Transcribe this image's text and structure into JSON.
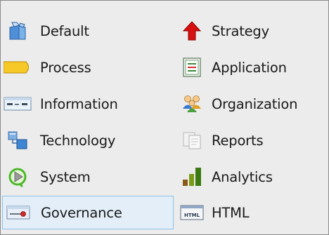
{
  "items": [
    {
      "label": "Default",
      "icon": "default-icon"
    },
    {
      "label": "Strategy",
      "icon": "strategy-icon"
    },
    {
      "label": "Process",
      "icon": "process-icon"
    },
    {
      "label": "Application",
      "icon": "application-icon"
    },
    {
      "label": "Information",
      "icon": "information-icon"
    },
    {
      "label": "Organization",
      "icon": "organization-icon"
    },
    {
      "label": "Technology",
      "icon": "technology-icon"
    },
    {
      "label": "Reports",
      "icon": "reports-icon"
    },
    {
      "label": "System",
      "icon": "system-icon"
    },
    {
      "label": "Analytics",
      "icon": "analytics-icon"
    },
    {
      "label": "Governance",
      "icon": "governance-icon",
      "selected": true
    },
    {
      "label": "HTML",
      "icon": "html-icon",
      "icon_text": "HTML"
    }
  ],
  "colors": {
    "selected_bg": "#e3eef9",
    "selected_border": "#8cc2ea",
    "panel_bg": "#ececec"
  }
}
